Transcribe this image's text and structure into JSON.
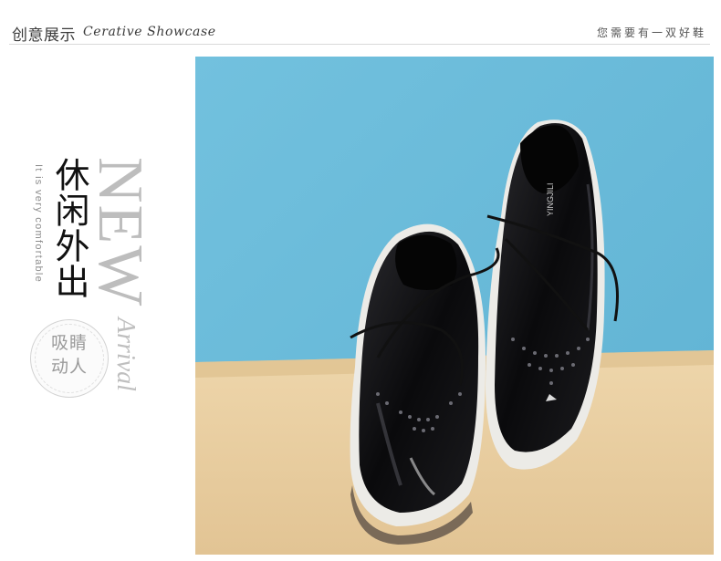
{
  "header": {
    "title_cn": "创意展示",
    "title_en": "Cerative  Showcase",
    "tagline": "您需要有一双好鞋"
  },
  "left_panel": {
    "vertical_en": "It is very comfortable",
    "vertical_cn": "休闲外出",
    "new_text": "NEW",
    "arrival_text": "Arrival",
    "badge_line1": "吸睛",
    "badge_line2": "动人"
  },
  "photo": {
    "brand_label": "YINGJILI",
    "colors": {
      "wall": "#6fbfdc",
      "floor": "#e7cda1",
      "shoe": "#0c0c0e",
      "sole": "#f1eeea"
    }
  }
}
